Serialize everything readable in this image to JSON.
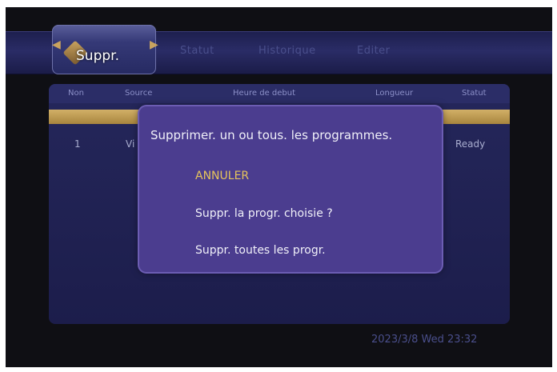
{
  "tabs": {
    "active": "Suppr.",
    "items": [
      "Statut",
      "Historique",
      "Editer"
    ]
  },
  "table": {
    "headers": [
      "Non",
      "Source",
      "Heure de debut",
      "Longueur",
      "Statut"
    ],
    "row": {
      "index": "1",
      "source": "Vi",
      "status": "Ready"
    }
  },
  "dialog": {
    "title": "Supprimer. un ou tous. les programmes.",
    "options": [
      "ANNULER",
      "Suppr. la progr. choisie ?",
      "Suppr. toutes les progr."
    ]
  },
  "status_bar": {
    "clock": "2023/3/8 Wed 23:32"
  },
  "colors": {
    "accent_gold": "#e6c45c",
    "dialog_bg": "#4b3d8f",
    "panel_bg": "#1c1d4b"
  }
}
